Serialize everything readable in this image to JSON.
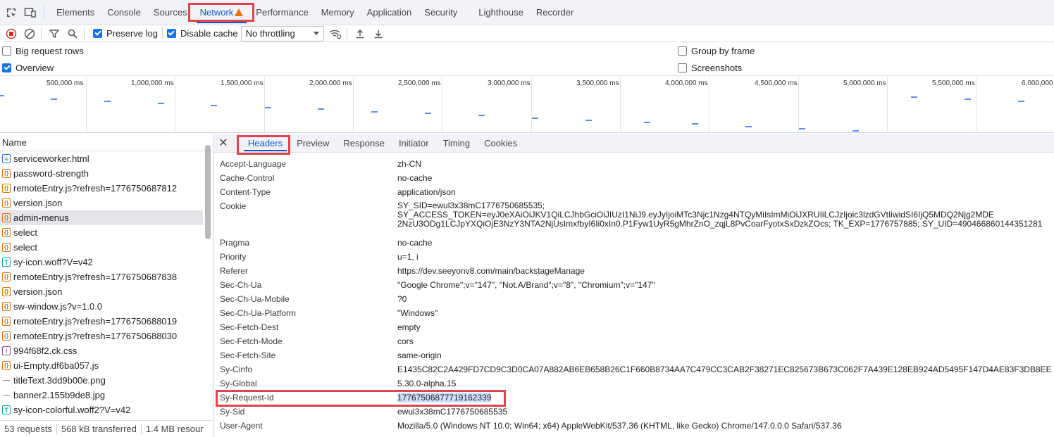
{
  "topbar": {
    "tabs": [
      "Elements",
      "Console",
      "Sources",
      "Network",
      "Performance",
      "Memory",
      "Application",
      "Security",
      "Lighthouse",
      "Recorder"
    ],
    "active_tab": "Network"
  },
  "toolbar": {
    "preserve_log": "Preserve log",
    "disable_cache": "Disable cache",
    "throttling": "No throttling"
  },
  "settings": {
    "big_request_rows": "Big request rows",
    "overview": "Overview",
    "group_by_frame": "Group by frame",
    "screenshots": "Screenshots"
  },
  "overview": {
    "ticks": [
      "500,000 ms",
      "1,000,000 ms",
      "1,500,000 ms",
      "2,000,000 ms",
      "2,500,000 ms",
      "3,000,000 ms",
      "3,500,000 ms",
      "4,000,000 ms",
      "4,500,000 ms",
      "5,000,000 ms",
      "5,500,000 ms",
      "6,000,000"
    ]
  },
  "requests": {
    "header": "Name",
    "items": [
      {
        "name": "serviceworker.html",
        "type": "doc"
      },
      {
        "name": "password-strength",
        "type": "fetch"
      },
      {
        "name": "remoteEntry.js?refresh=1776750687812",
        "type": "fetch"
      },
      {
        "name": "version.json",
        "type": "fetch"
      },
      {
        "name": "admin-menus",
        "type": "fetch"
      },
      {
        "name": "select",
        "type": "fetch"
      },
      {
        "name": "select",
        "type": "fetch"
      },
      {
        "name": "sy-icon.woff?V=v42",
        "type": "font"
      },
      {
        "name": "remoteEntry.js?refresh=1776750687838",
        "type": "fetch"
      },
      {
        "name": "version.json",
        "type": "fetch"
      },
      {
        "name": "sw-window.js?v=1.0.0",
        "type": "fetch"
      },
      {
        "name": "remoteEntry.js?refresh=1776750688019",
        "type": "fetch"
      },
      {
        "name": "remoteEntry.js?refresh=1776750688030",
        "type": "fetch"
      },
      {
        "name": "994f68f2.ck.css",
        "type": "css"
      },
      {
        "name": "ui-Empty.df6ba057.js",
        "type": "fetch"
      },
      {
        "name": "titleText.3dd9b00e.png",
        "type": "img"
      },
      {
        "name": "banner2.155b9de8.jpg",
        "type": "img"
      },
      {
        "name": "sy-icon-colorful.woff2?V=v42",
        "type": "font"
      }
    ],
    "status": {
      "requests": "53 requests",
      "transferred": "568 kB transferred",
      "resources": "1.4 MB resour"
    }
  },
  "detail": {
    "tabs": [
      "Headers",
      "Preview",
      "Response",
      "Initiator",
      "Timing",
      "Cookies"
    ],
    "active_tab": "Headers",
    "headers": [
      {
        "key": "Accept-Language",
        "value": "zh-CN"
      },
      {
        "key": "Cache-Control",
        "value": "no-cache"
      },
      {
        "key": "Content-Type",
        "value": "application/json"
      },
      {
        "key": "Cookie",
        "value": "SY_SID=ewul3x38mC1776750685535;",
        "value2": "SY_ACCESS_TOKEN=eyJ0eXAiOiJKV1QiLCJhbGciOiJIUzI1NiJ9.eyJyIjoiMTc3Njc1Nzg4NTQyMiIsImMiOiJXRUIiLCJzIjoic3lzdGVtIiwidSI6IjQ5MDQ2Njg2MDE",
        "value3": "2NzU3ODg1LCJpYXQiOjE3NzY3NTA2NjUsImxfbyI6Ii0xIn0.P1Fyw1UyR5gMhrZnO_zqjL8PvCoarFyotxSxDzkZOcs; TK_EXP=1776757885; SY_UID=490466860144351281"
      },
      {
        "key": "Pragma",
        "value": "no-cache"
      },
      {
        "key": "Priority",
        "value": "u=1, i"
      },
      {
        "key": "Referer",
        "value": "https://dev.seeyonv8.com/main/backstageManage"
      },
      {
        "key": "Sec-Ch-Ua",
        "value": "\"Google Chrome\";v=\"147\", \"Not.A/Brand\";v=\"8\", \"Chromium\";v=\"147\""
      },
      {
        "key": "Sec-Ch-Ua-Mobile",
        "value": "?0"
      },
      {
        "key": "Sec-Ch-Ua-Platform",
        "value": "\"Windows\""
      },
      {
        "key": "Sec-Fetch-Dest",
        "value": "empty"
      },
      {
        "key": "Sec-Fetch-Mode",
        "value": "cors"
      },
      {
        "key": "Sec-Fetch-Site",
        "value": "same-origin"
      },
      {
        "key": "Sy-Cinfo",
        "value": "E1435C82C2A429FD7CD9C3D0CA07A882AB6EB658B26C1F660B8734AA7C479CC3CAB2F38271EC825673B673C062F7A439E128EB924AD5495F147D4AE83F3DB8EE"
      },
      {
        "key": "Sy-Global",
        "value": "5.30.0-alpha.15"
      },
      {
        "key": "Sy-Request-Id",
        "value": "17767506877719162339"
      },
      {
        "key": "Sy-Sid",
        "value": "ewul3x38mC1776750685535"
      },
      {
        "key": "User-Agent",
        "value": "Mozilla/5.0 (Windows NT 10.0; Win64; x64) AppleWebKit/537.36 (KHTML, like Gecko) Chrome/147.0.0.0 Safari/537.36"
      }
    ]
  }
}
